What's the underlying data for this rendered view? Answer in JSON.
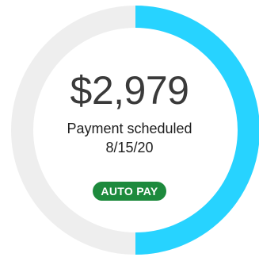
{
  "payment": {
    "amount": "$2,979",
    "status": "Payment scheduled",
    "date": "8/15/20",
    "badge": "AUTO PAY",
    "progress_fraction": 0.5
  },
  "colors": {
    "ring_track": "#eeeeee",
    "ring_fill": "#27d3ff",
    "badge_bg": "#1d8a3d",
    "badge_text": "#ffffff"
  }
}
